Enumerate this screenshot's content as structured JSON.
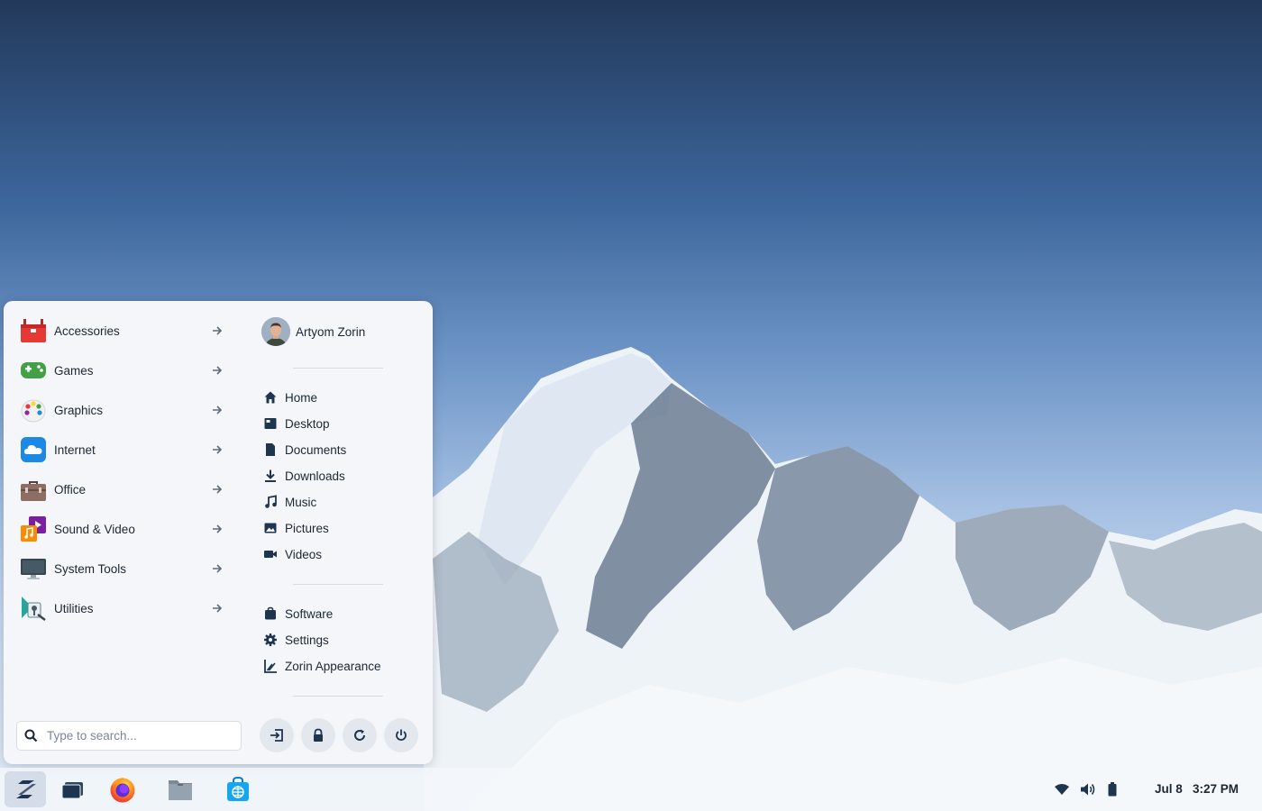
{
  "menu": {
    "categories": [
      {
        "label": "Accessories",
        "icon": "toolbox-icon"
      },
      {
        "label": "Games",
        "icon": "gamepad-icon"
      },
      {
        "label": "Graphics",
        "icon": "palette-icon"
      },
      {
        "label": "Internet",
        "icon": "cloud-icon"
      },
      {
        "label": "Office",
        "icon": "briefcase-icon"
      },
      {
        "label": "Sound & Video",
        "icon": "media-icon"
      },
      {
        "label": "System Tools",
        "icon": "monitor-icon"
      },
      {
        "label": "Utilities",
        "icon": "utilities-icon"
      }
    ],
    "user": {
      "name": "Artyom Zorin"
    },
    "places": [
      {
        "label": "Home",
        "icon": "home-icon"
      },
      {
        "label": "Desktop",
        "icon": "desktop-icon"
      },
      {
        "label": "Documents",
        "icon": "document-icon"
      },
      {
        "label": "Downloads",
        "icon": "download-icon"
      },
      {
        "label": "Music",
        "icon": "music-icon"
      },
      {
        "label": "Pictures",
        "icon": "image-icon"
      },
      {
        "label": "Videos",
        "icon": "video-icon"
      }
    ],
    "system": [
      {
        "label": "Software",
        "icon": "bag-icon"
      },
      {
        "label": "Settings",
        "icon": "gear-icon"
      },
      {
        "label": "Zorin Appearance",
        "icon": "appearance-icon"
      }
    ],
    "search": {
      "placeholder": "Type to search...",
      "value": ""
    },
    "power_buttons": [
      "logout-icon",
      "lock-icon",
      "restart-icon",
      "power-icon"
    ]
  },
  "taskbar": {
    "apps": [
      "zorin-menu-icon",
      "workspaces-icon",
      "firefox-icon",
      "files-icon",
      "software-store-icon"
    ],
    "tray": [
      "wifi-icon",
      "volume-icon",
      "battery-icon"
    ],
    "date": "Jul 8",
    "time": "3:27 PM"
  },
  "colors": {
    "accent": "#15a6f0",
    "menu_bg": "#f4f6f9",
    "text": "#1d2733",
    "icon_dark": "#1e3550"
  }
}
